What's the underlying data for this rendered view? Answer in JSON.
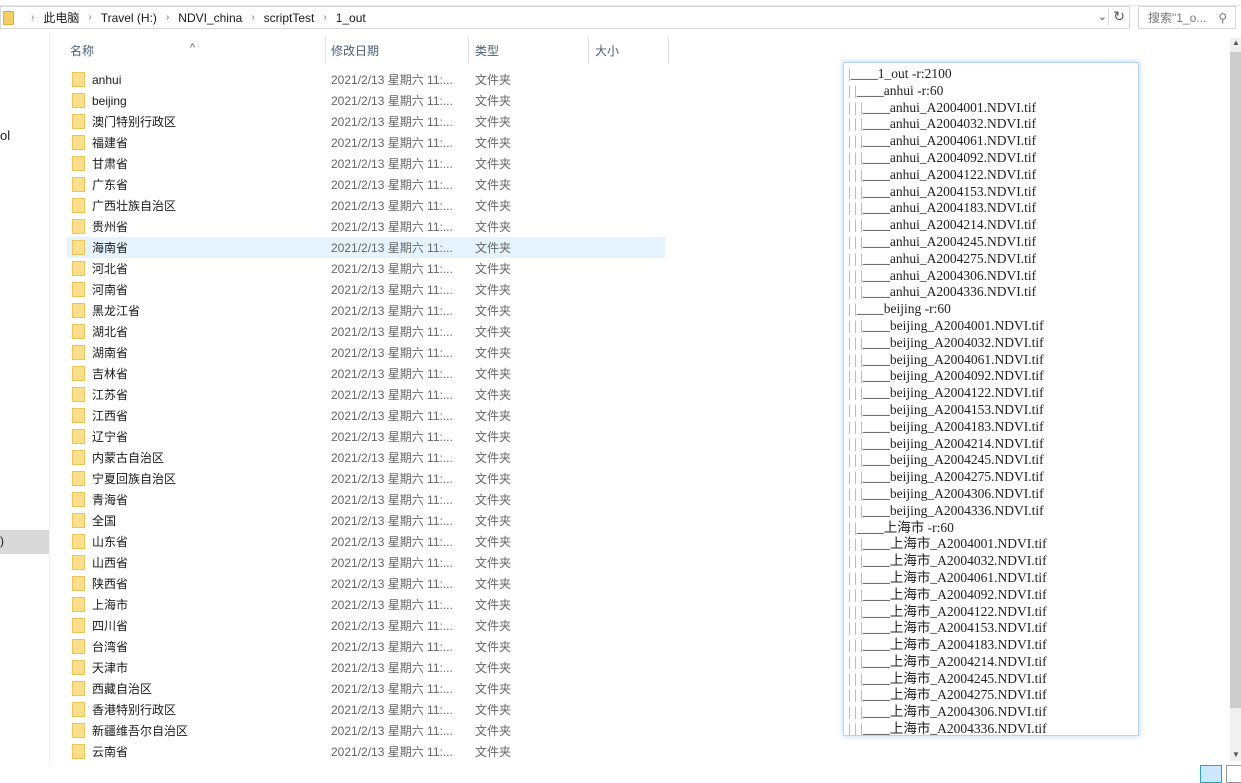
{
  "breadcrumb": [
    "此电脑",
    "Travel (H:)",
    "NDVI_china",
    "scriptTest",
    "1_out"
  ],
  "search": {
    "placeholder": "搜索\"1_o..."
  },
  "nav": {
    "item1": "ol",
    "selected": ")"
  },
  "columns": {
    "name": "名称",
    "date": "修改日期",
    "type": "类型",
    "size": "大小"
  },
  "files": [
    {
      "name": "anhui"
    },
    {
      "name": "beijing"
    },
    {
      "name": "澳门特别行政区"
    },
    {
      "name": "福建省"
    },
    {
      "name": "甘肃省"
    },
    {
      "name": "广东省"
    },
    {
      "name": "广西壮族自治区"
    },
    {
      "name": "贵州省"
    },
    {
      "name": "海南省",
      "hover": true
    },
    {
      "name": "河北省"
    },
    {
      "name": "河南省"
    },
    {
      "name": "黑龙江省"
    },
    {
      "name": "湖北省"
    },
    {
      "name": "湖南省"
    },
    {
      "name": "吉林省"
    },
    {
      "name": "江苏省"
    },
    {
      "name": "江西省"
    },
    {
      "name": "辽宁省"
    },
    {
      "name": "内蒙古自治区"
    },
    {
      "name": "宁夏回族自治区"
    },
    {
      "name": "青海省"
    },
    {
      "name": "全国"
    },
    {
      "name": "山东省"
    },
    {
      "name": "山西省"
    },
    {
      "name": "陕西省"
    },
    {
      "name": "上海市"
    },
    {
      "name": "四川省"
    },
    {
      "name": "台湾省"
    },
    {
      "name": "天津市"
    },
    {
      "name": "西藏自治区"
    },
    {
      "name": "香港特别行政区"
    },
    {
      "name": "新疆维吾尔自治区"
    },
    {
      "name": "云南省"
    }
  ],
  "file_date": "2021/2/13 星期六 11:...",
  "file_type": "文件夹",
  "tree": [
    {
      "p": "|",
      "t": "____1_out -r:2100"
    },
    {
      "p": "| |",
      "t": "____anhui -r:60"
    },
    {
      "p": "| | |",
      "t": "____anhui_A2004001.NDVI.tif"
    },
    {
      "p": "| | |",
      "t": "____anhui_A2004032.NDVI.tif"
    },
    {
      "p": "| | |",
      "t": "____anhui_A2004061.NDVI.tif"
    },
    {
      "p": "| | |",
      "t": "____anhui_A2004092.NDVI.tif"
    },
    {
      "p": "| | |",
      "t": "____anhui_A2004122.NDVI.tif"
    },
    {
      "p": "| | |",
      "t": "____anhui_A2004153.NDVI.tif"
    },
    {
      "p": "| | |",
      "t": "____anhui_A2004183.NDVI.tif"
    },
    {
      "p": "| | |",
      "t": "____anhui_A2004214.NDVI.tif"
    },
    {
      "p": "| | |",
      "t": "____anhui_A2004245.NDVI.tif"
    },
    {
      "p": "| | |",
      "t": "____anhui_A2004275.NDVI.tif"
    },
    {
      "p": "| | |",
      "t": "____anhui_A2004306.NDVI.tif"
    },
    {
      "p": "| | |",
      "t": "____anhui_A2004336.NDVI.tif"
    },
    {
      "p": "| |",
      "t": "____beijing -r:60"
    },
    {
      "p": "| | |",
      "t": "____beijing_A2004001.NDVI.tif"
    },
    {
      "p": "| | |",
      "t": "____beijing_A2004032.NDVI.tif"
    },
    {
      "p": "| | |",
      "t": "____beijing_A2004061.NDVI.tif"
    },
    {
      "p": "| | |",
      "t": "____beijing_A2004092.NDVI.tif"
    },
    {
      "p": "| | |",
      "t": "____beijing_A2004122.NDVI.tif"
    },
    {
      "p": "| | |",
      "t": "____beijing_A2004153.NDVI.tif"
    },
    {
      "p": "| | |",
      "t": "____beijing_A2004183.NDVI.tif"
    },
    {
      "p": "| | |",
      "t": "____beijing_A2004214.NDVI.tif"
    },
    {
      "p": "| | |",
      "t": "____beijing_A2004245.NDVI.tif"
    },
    {
      "p": "| | |",
      "t": "____beijing_A2004275.NDVI.tif"
    },
    {
      "p": "| | |",
      "t": "____beijing_A2004306.NDVI.tif"
    },
    {
      "p": "| | |",
      "t": "____beijing_A2004336.NDVI.tif"
    },
    {
      "p": "| |",
      "t": "____上海市 -r:60"
    },
    {
      "p": "| | |",
      "t": "____上海市_A2004001.NDVI.tif"
    },
    {
      "p": "| | |",
      "t": "____上海市_A2004032.NDVI.tif"
    },
    {
      "p": "| | |",
      "t": "____上海市_A2004061.NDVI.tif"
    },
    {
      "p": "| | |",
      "t": "____上海市_A2004092.NDVI.tif"
    },
    {
      "p": "| | |",
      "t": "____上海市_A2004122.NDVI.tif"
    },
    {
      "p": "| | |",
      "t": "____上海市_A2004153.NDVI.tif"
    },
    {
      "p": "| | |",
      "t": "____上海市_A2004183.NDVI.tif"
    },
    {
      "p": "| | |",
      "t": "____上海市_A2004214.NDVI.tif"
    },
    {
      "p": "| | |",
      "t": "____上海市_A2004245.NDVI.tif"
    },
    {
      "p": "| | |",
      "t": "____上海市_A2004275.NDVI.tif"
    },
    {
      "p": "| | |",
      "t": "____上海市_A2004306.NDVI.tif"
    },
    {
      "p": "| | |",
      "t": "____上海市_A2004336.NDVI.tif"
    }
  ]
}
